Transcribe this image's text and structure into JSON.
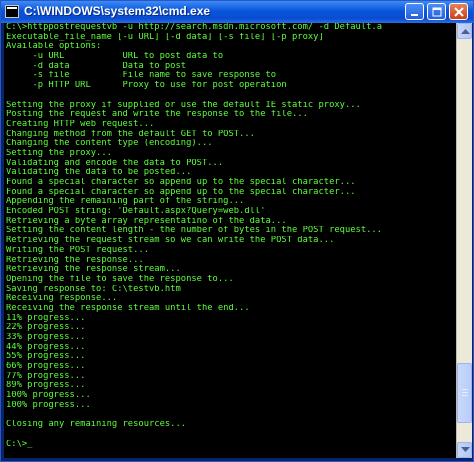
{
  "window": {
    "title": "C:\\WINDOWS\\system32\\cmd.exe"
  },
  "console": {
    "lines": [
      "C:\\>httppostrequestvb -u http://search.msdn.microsoft.com/ -d Default.a",
      "Executable_file_name [-u URL] [-d data] [-s file] [-p proxy]",
      "Available options:",
      "     -u URL           URL to post data to",
      "     -d data          Data to post",
      "     -s file          File name to save response to",
      "     -p HTTP URL      Proxy to use for post operation",
      "",
      "Setting the proxy if supplied or use the default IE static proxy...",
      "Posting the request and write the response to the file...",
      "Creating HTTP web request...",
      "Changing method from the default GET to POST...",
      "Changing the content type (encoding)...",
      "Setting the proxy...",
      "Validating and encode the data to POST...",
      "Validating the data to be posted...",
      "Found a special character so append up to the special character...",
      "Found a special character so append up to the special character...",
      "Appending the remaining part of the string...",
      "Encoded POST string: 'Default.aspx?Query=web.dll'",
      "Retrieving a byte array representatino of the data...",
      "Setting the content length - the number of bytes in the POST request...",
      "Retrieving the request stream so we can write the POST data...",
      "Writing the POST request...",
      "Retrieving the response...",
      "Retrieving the response stream...",
      "Opening the file to save the response to...",
      "Saving response to: C:\\testvb.htm",
      "Receiving response...",
      "Receiving the response stream until the end...",
      "11% progress...",
      "22% progress...",
      "33% progress...",
      "44% progress...",
      "55% progress...",
      "66% progress...",
      "77% progress...",
      "89% progress...",
      "100% progress...",
      "100% progress...",
      "",
      "Closing any remaining resources...",
      "",
      "C:\\>_"
    ]
  },
  "colors": {
    "console_text": "#5dff3b",
    "console_bg": "#000000",
    "titlebar": "#0a4ccf"
  },
  "icons": [
    "cmd-app-icon",
    "minimize-icon",
    "maximize-icon",
    "close-icon",
    "scroll-up-arrow-icon",
    "scroll-down-arrow-icon"
  ]
}
